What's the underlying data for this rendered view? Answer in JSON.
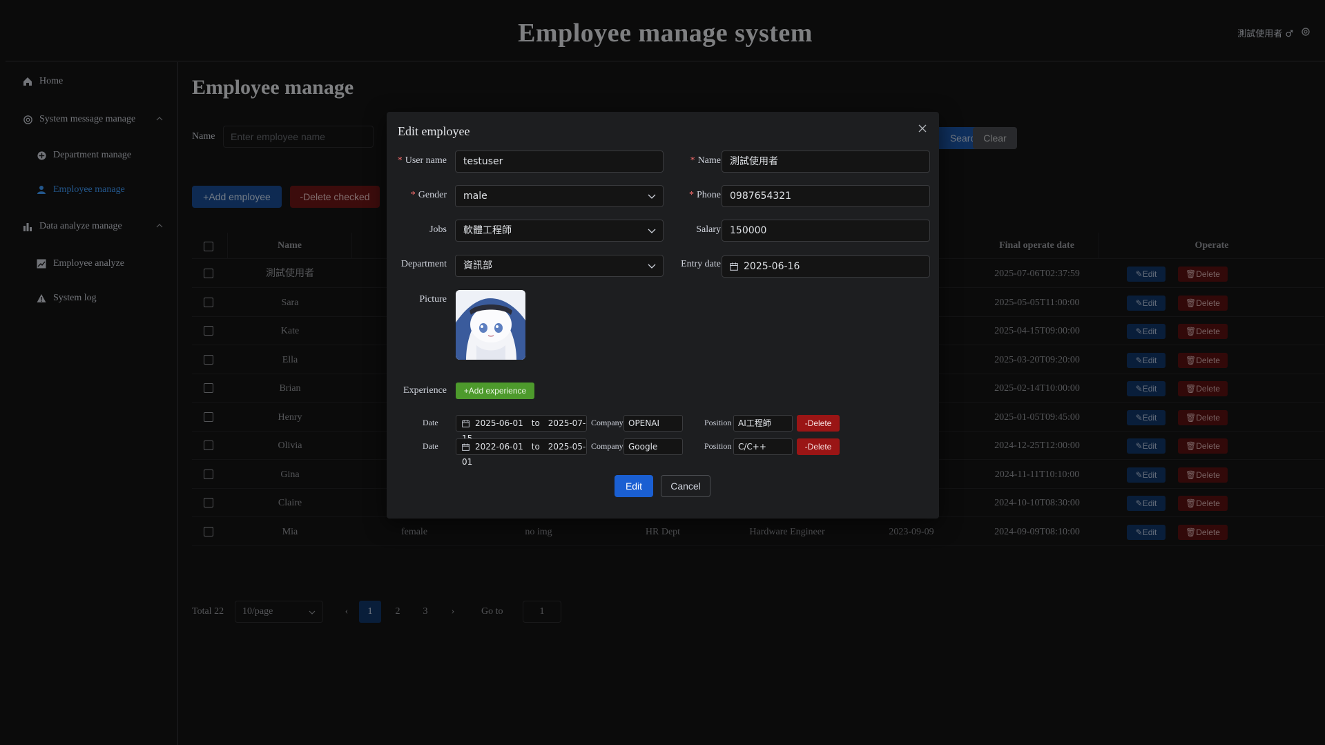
{
  "header": {
    "title": "Employee manage system",
    "user": "測試使用者"
  },
  "sidebar": {
    "items": [
      {
        "label": "Home",
        "icon": "home-icon"
      },
      {
        "label": "System message manage",
        "icon": "gear-icon"
      },
      {
        "label": "Department manage",
        "icon": "department-icon"
      },
      {
        "label": "Employee manage",
        "icon": "user-icon"
      },
      {
        "label": "Data analyze manage",
        "icon": "bar-chart-icon"
      },
      {
        "label": "Employee analyze",
        "icon": "trend-chart-icon"
      },
      {
        "label": "System log",
        "icon": "warning-icon"
      }
    ]
  },
  "main": {
    "title": "Employee manage",
    "search": {
      "label": "Name",
      "placeholder": "Enter employee name",
      "search_label": "Search",
      "clear_label": "Clear"
    },
    "add_label": "+Add employee",
    "delete_checked_label": "-Delete checked"
  },
  "table": {
    "headers": [
      "Name",
      "Final operate date",
      "Operate"
    ],
    "edit_label": "Edit",
    "delete_label": "Delete",
    "rows": [
      {
        "name": "測試使用者",
        "date": "2025-07-06T02:37:59"
      },
      {
        "name": "Sara",
        "date": "2025-05-05T11:00:00"
      },
      {
        "name": "Kate",
        "date": "2025-04-15T09:00:00"
      },
      {
        "name": "Ella",
        "date": "2025-03-20T09:20:00"
      },
      {
        "name": "Brian",
        "date": "2025-02-14T10:00:00"
      },
      {
        "name": "Henry",
        "date": "2025-01-05T09:45:00"
      },
      {
        "name": "Olivia",
        "date": "2024-12-25T12:00:00"
      },
      {
        "name": "Gina",
        "date": "2024-11-11T10:10:00"
      },
      {
        "name": "Claire",
        "date": "2024-10-10T08:30:00"
      },
      {
        "name": "Mia",
        "date": "2024-09-09T08:10:00",
        "gender": "female",
        "img": "no img",
        "dept": "HR Dept",
        "job": "Hardware Engineer",
        "entry": "2023-09-09"
      }
    ]
  },
  "pager": {
    "total": "Total 22",
    "size": "10/page",
    "pages": [
      "1",
      "2",
      "3"
    ],
    "goto": "Go to",
    "goto_value": "1"
  },
  "dialog": {
    "title": "Edit employee",
    "username_label": "User name",
    "username": "testuser",
    "name_label": "Name",
    "name": "測試使用者",
    "gender_label": "Gender",
    "gender": "male",
    "phone_label": "Phone",
    "phone": "0987654321",
    "jobs_label": "Jobs",
    "jobs": "軟體工程師",
    "salary_label": "Salary",
    "salary": "150000",
    "department_label": "Department",
    "department": "資訊部",
    "entry_label": "Entry date",
    "entry": "2025-06-16",
    "picture_label": "Picture",
    "experience_label": "Experience",
    "add_experience_label": "+Add experience",
    "experiences": [
      {
        "date_label": "Date",
        "from": "2025-06-01",
        "to_label": "to",
        "to": "2025-07-15",
        "company_label": "Company",
        "company": "OPENAI",
        "position_label": "Position",
        "position": "AI工程師",
        "delete_label": "-Delete"
      },
      {
        "date_label": "Date",
        "from": "2022-06-01",
        "to_label": "to",
        "to": "2025-05-01",
        "company_label": "Company",
        "company": "Google",
        "position_label": "Position",
        "position": "C/C++",
        "delete_label": "-Delete"
      }
    ],
    "edit_label": "Edit",
    "cancel_label": "Cancel"
  }
}
